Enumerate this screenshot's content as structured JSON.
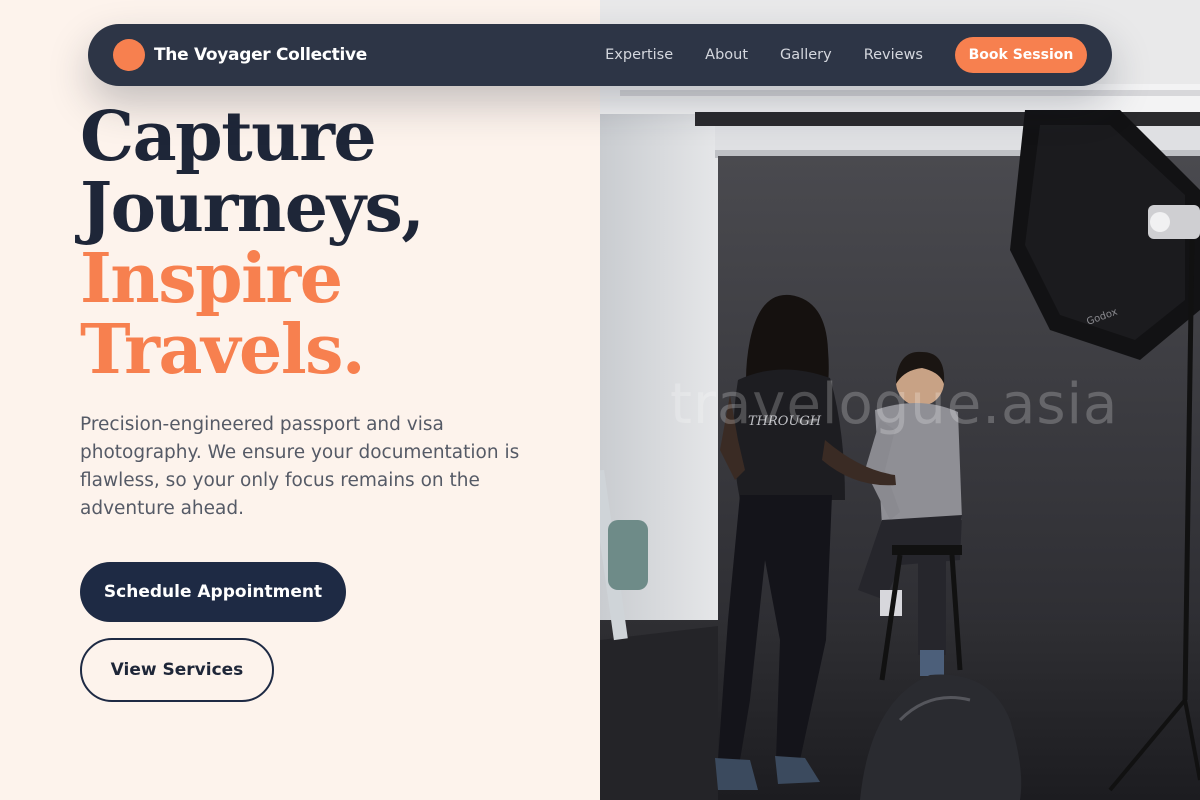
{
  "nav": {
    "brand_name": "The Voyager Collective",
    "links": [
      "Expertise",
      "About",
      "Gallery",
      "Reviews"
    ],
    "cta_label": "Book Session"
  },
  "hero": {
    "headline_dark": [
      "Capture",
      "Journeys,"
    ],
    "headline_accent": [
      "Inspire",
      "Travels."
    ],
    "tagline": "Precision-engineered passport and visa photography. We ensure your documentation is flawless, so your only focus remains on the adventure ahead.",
    "primary_button": "Schedule Appointment",
    "secondary_button": "View Services"
  },
  "photo": {
    "watermark": "travelogue.asia",
    "tshirt_text": "THROUGH",
    "softbox_brand": "Godox"
  },
  "colors": {
    "accent": "#f7804f",
    "navy": "#1e2a44",
    "background": "#fdf3ec",
    "nav_bg": "#2d3546"
  }
}
